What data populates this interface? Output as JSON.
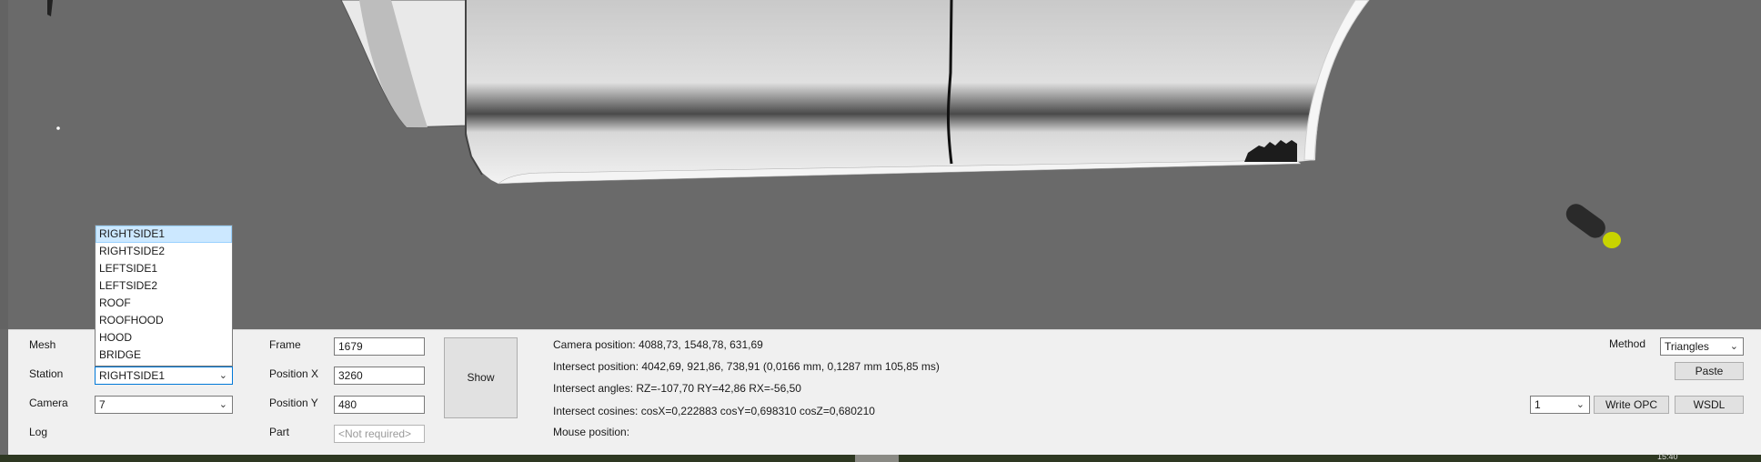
{
  "panel": {
    "mesh_label": "Mesh",
    "station_label": "Station",
    "station_value": "RIGHTSIDE1",
    "camera_label": "Camera",
    "camera_value": "7",
    "log_label": "Log",
    "frame_label": "Frame",
    "frame_value": "1679",
    "position_x_label": "Position X",
    "position_x_value": "3260",
    "position_y_label": "Position Y",
    "position_y_value": "480",
    "part_label": "Part",
    "part_placeholder": "<Not required>",
    "show_button": "Show",
    "camera_position": "Camera position: 4088,73, 1548,78, 631,69",
    "intersect_position": "Intersect position: 4042,69, 921,86, 738,91 (0,0166 mm, 0,1287 mm 105,85 ms)",
    "intersect_angles": "Intersect angles: RZ=-107,70 RY=42,86 RX=-56,50",
    "intersect_cosines": "Intersect cosines: cosX=0,222883 cosY=0,698310 cosZ=0,680210",
    "mouse_position": "Mouse position:",
    "method_label": "Method",
    "method_value": "Triangles",
    "paste_button": "Paste",
    "opc_select_value": "1",
    "write_opc_button": "Write OPC",
    "wsdl_button": "WSDL"
  },
  "station_dropdown": {
    "options": [
      "RIGHTSIDE1",
      "RIGHTSIDE2",
      "LEFTSIDE1",
      "LEFTSIDE2",
      "ROOF",
      "ROOFHOOD",
      "HOOD",
      "BRIDGE"
    ],
    "selected": "RIGHTSIDE1"
  },
  "taskbar": {
    "clock": "15:40"
  },
  "colors": {
    "viewport_bg": "#6a6a6a",
    "panel_bg": "#f0f0f0",
    "selection_bg": "#cce8ff",
    "focus_border": "#0078d7",
    "marker_tip": "#c8d400"
  },
  "icons": [
    "chevron-down-icon"
  ]
}
